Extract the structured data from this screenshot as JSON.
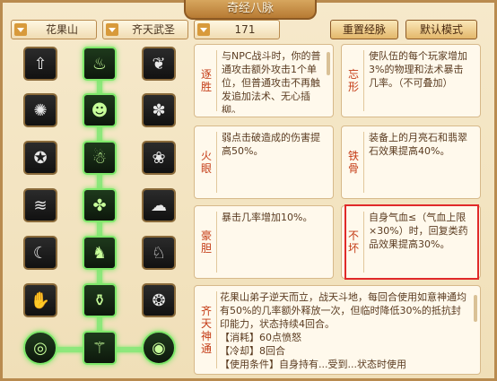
{
  "window": {
    "title": "奇经八脉"
  },
  "controls": {
    "sect_select": "花果山",
    "school_select": "齐天武圣",
    "level_select": "171",
    "reset_button": "重置经脉",
    "default_button": "默认模式"
  },
  "talents": [
    {
      "name": "逐胜",
      "desc": "与NPC战斗时，你的普通攻击额外攻击1个单位，但普通攻击不再触发追加法术、无心插柳。"
    },
    {
      "name": "忘形",
      "desc": "使队伍的每个玩家增加3%的物理和法术暴击几率。（不可叠加）"
    },
    {
      "name": "火眼",
      "desc": "弱点击破造成的伤害提高50%。"
    },
    {
      "name": "铁骨",
      "desc": "装备上的月亮石和翡翠石效果提高40%。"
    },
    {
      "name": "豪胆",
      "desc": "暴击几率增加10%。"
    },
    {
      "name": "不坏",
      "desc": "自身气血≤（气血上限×30%）时，回复类药品效果提高30%。"
    }
  ],
  "final_talent": {
    "name": "齐天神通",
    "desc": "花果山弟子逆天而立，战天斗地，每回合使用如意神通均有50%的几率额外释放一次，但临时降低30%的抵抗封印能力，状态持续4回合。",
    "cost": "【消耗】60点愤怒",
    "cooldown": "【冷却】8回合",
    "extra": "【使用条件】自身持有...受到...状态时使用"
  },
  "grid_icons": [
    [
      "up-arrow-icon",
      "flame-spiral-icon",
      "wing-icon"
    ],
    [
      "fire-swirl-icon",
      "tiger-head-icon",
      "swirl-icon"
    ],
    [
      "head-gear-icon",
      "ghost-icon",
      "curl-icon"
    ],
    [
      "wind-icon",
      "fan-icon",
      "cloud-swirl-icon"
    ],
    [
      "crescent-icon",
      "person-icon",
      "claw-icon"
    ],
    [
      "hand-icon",
      "bottle-icon",
      "seal-icon"
    ],
    [
      "ring-icon",
      "staff-icon",
      "orb-icon"
    ]
  ],
  "colors": {
    "highlight": "#7fe86a",
    "talent_name": "#c43c16",
    "selection_box": "#e02a2a"
  }
}
